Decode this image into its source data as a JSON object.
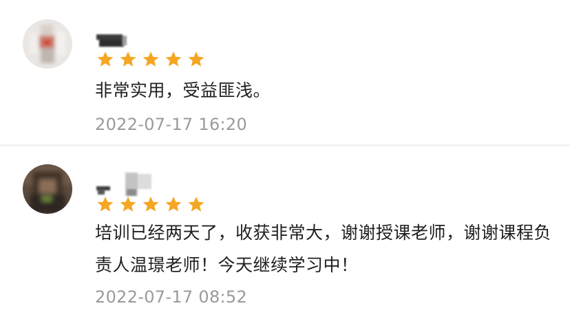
{
  "colors": {
    "star": "#f5a623",
    "comment_text": "#1f1f1f",
    "timestamp_text": "#9a9a9a",
    "divider": "#f2f2f2"
  },
  "reviews": [
    {
      "rating": 5,
      "comment": "非常实用，受益匪浅。",
      "timestamp": "2022-07-17 16:20"
    },
    {
      "rating": 5,
      "comment": "培训已经两天了，收获非常大，谢谢授课老师，谢谢课程负责人温璟老师！今天继续学习中！",
      "timestamp": "2022-07-17 08:52"
    }
  ]
}
